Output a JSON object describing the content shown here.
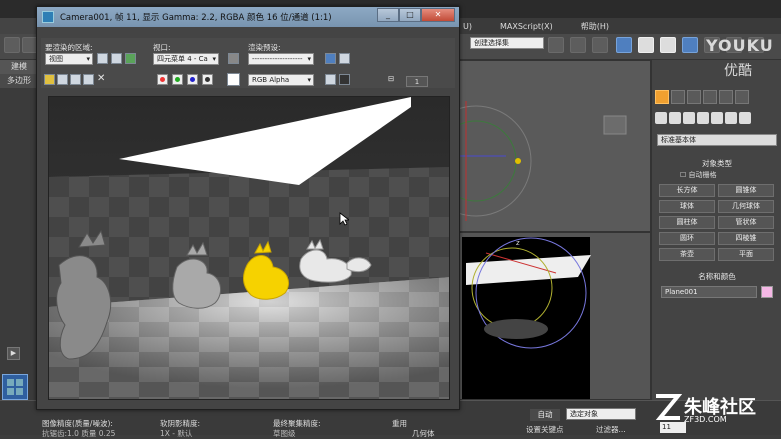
{
  "render_window": {
    "title": "Camera001, 帧 11, 显示 Gamma: 2.2, RGBA 颜色 16 位/通道 (1:1)",
    "area_label": "要渲染的区域:",
    "area_value": "视图",
    "viewport_label": "视口:",
    "viewport_value": "四元菜单 4 - Ca",
    "preset_label": "渲染预设:",
    "preset_value": "--------------------",
    "channel_value": "RGB Alpha",
    "spinner_value": "1",
    "minimize": "_",
    "maximize": "□",
    "close": "✕"
  },
  "max": {
    "menu": [
      "U)",
      "MAXScript(X)",
      "帮助(H)"
    ],
    "selection_set": "创建选择集",
    "left_tabs": [
      "建模",
      "多边形"
    ]
  },
  "command_panel": {
    "category": "标准基本体",
    "object_type_header": "对象类型",
    "autogrid": "自动栅格",
    "buttons": [
      "长方体",
      "圆锥体",
      "球体",
      "几何球体",
      "圆柱体",
      "管状体",
      "圆环",
      "四棱锥",
      "茶壶",
      "平面"
    ],
    "name_color_header": "名称和颜色",
    "object_name": "Plane001",
    "object_color": "#f5b8e6"
  },
  "bottom": {
    "labels": [
      "图像精度(质量/噪波):",
      "抗锯齿:1.0  质量 0.25",
      "软阴影精度:",
      "1X - 默认",
      "最终聚集精度:",
      "草图级",
      "重用",
      "几何体"
    ],
    "auto_key": "自动",
    "set_key": "设置关键点",
    "selection_dropdown": "选定对象",
    "filter": "过滤器...",
    "frame_value": "11"
  },
  "watermarks": {
    "youku": "YOUKU",
    "youku_cn": "优酷",
    "site_name": "朱峰社区",
    "site_url": "ZF3D.COM"
  },
  "colors": {
    "accent_blue": "#4f7fbf",
    "dragon_yellow": "#f6d200",
    "title_bar": "#8da9c4"
  }
}
